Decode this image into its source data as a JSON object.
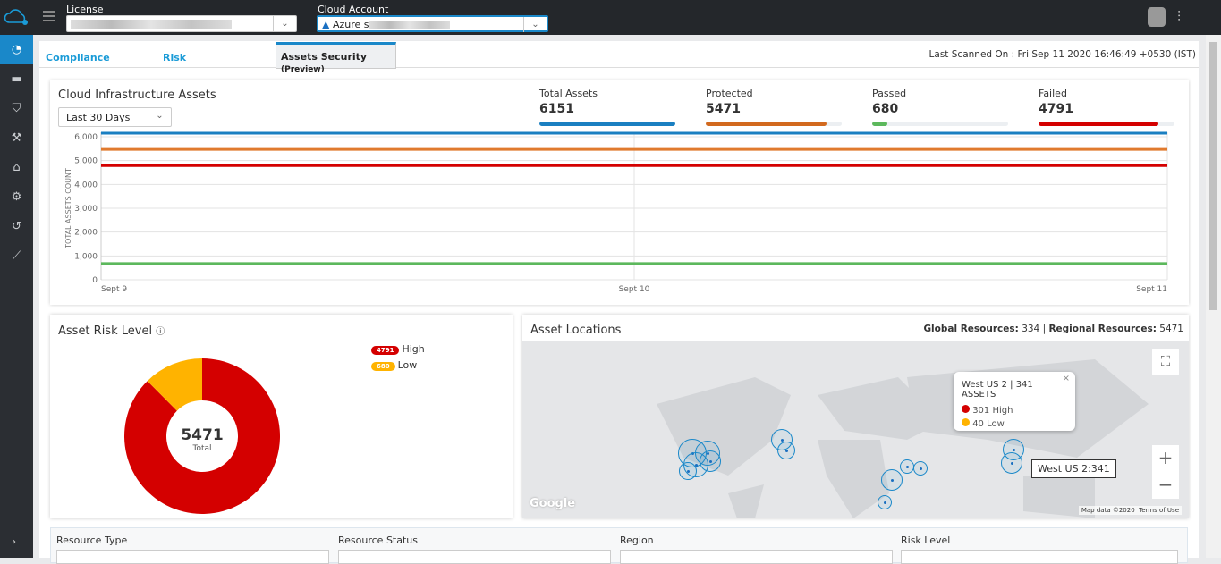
{
  "header": {
    "license_label": "License",
    "cloud_account_label": "Cloud Account",
    "cloud_account_value": "Azure s"
  },
  "sidebar": {
    "items": [
      "dashboard-icon",
      "briefcase-icon",
      "shield-icon",
      "hammer-icon",
      "bank-icon",
      "gears-icon",
      "history-icon",
      "chart-icon"
    ]
  },
  "tabs": [
    {
      "label": "Compliance"
    },
    {
      "label": "Risk"
    },
    {
      "label": "Assets Security",
      "suffix": "(Preview)"
    }
  ],
  "last_scanned": "Last Scanned On : Fri Sep 11 2020 16:46:49 +0530 (IST)",
  "infra": {
    "title": "Cloud Infrastructure Assets",
    "range": "Last 30 Days",
    "stats": [
      {
        "label": "Total Assets",
        "value": "6151",
        "color": "#1a7fc1",
        "fill": 1
      },
      {
        "label": "Protected",
        "value": "5471",
        "color": "#d2691e",
        "fill": 0.89
      },
      {
        "label": "Passed",
        "value": "680",
        "color": "#5cb85c",
        "fill": 0.11
      },
      {
        "label": "Failed",
        "value": "4791",
        "color": "#d40000",
        "fill": 0.88
      }
    ]
  },
  "chart_data": {
    "type": "line",
    "ylabel": "TOTAL ASSETS COUNT",
    "x": [
      "Sept 9",
      "Sept 10",
      "Sept 11"
    ],
    "ylim": [
      0,
      6000
    ],
    "yticks": [
      "0",
      "1,000",
      "2,000",
      "3,000",
      "4,000",
      "5,000",
      "6,000"
    ],
    "grid": true,
    "series": [
      {
        "name": "Total Assets",
        "color": "#1a7fc1",
        "values": [
          6151,
          6151,
          6151
        ]
      },
      {
        "name": "Protected",
        "color": "#e07a2e",
        "values": [
          5471,
          5471,
          5471
        ]
      },
      {
        "name": "Failed",
        "color": "#d40000",
        "values": [
          4791,
          4791,
          4791
        ]
      },
      {
        "name": "Passed",
        "color": "#5cb85c",
        "values": [
          680,
          680,
          680
        ]
      }
    ]
  },
  "risk": {
    "title": "Asset Risk Level",
    "total": "5471",
    "total_label": "Total",
    "legend": [
      {
        "count": "4791",
        "label": "High",
        "color": "#d40000",
        "value": 4791
      },
      {
        "count": "680",
        "label": "Low",
        "color": "#ffb300",
        "value": 680
      }
    ]
  },
  "locations": {
    "title": "Asset Locations",
    "global_label": "Global Resources:",
    "global": "334",
    "regional_label": "Regional Resources:",
    "regional": "5471",
    "popup": {
      "title": "West US 2 | 341 ASSETS",
      "high": "301 High",
      "low": "40 Low"
    },
    "tooltip": "West US 2:341",
    "map_data": "Map data ©2020",
    "terms": "Terms of Use",
    "google": "Google"
  },
  "filters": [
    "Resource Type",
    "Resource Status",
    "Region",
    "Risk Level"
  ]
}
